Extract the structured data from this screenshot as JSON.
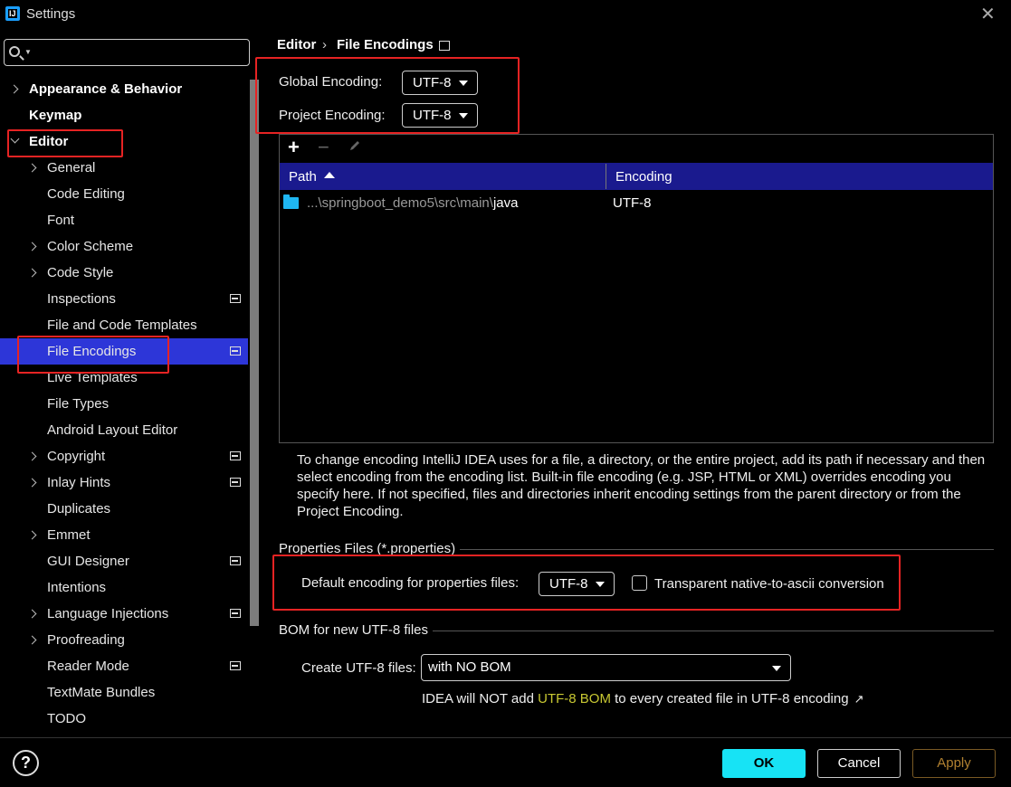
{
  "window": {
    "title": "Settings",
    "app_icon_text": "IJ"
  },
  "search": {
    "placeholder": ""
  },
  "sidebar": {
    "items": [
      {
        "label": "Appearance & Behavior"
      },
      {
        "label": "Keymap"
      },
      {
        "label": "Editor"
      },
      {
        "label": "General"
      },
      {
        "label": "Code Editing"
      },
      {
        "label": "Font"
      },
      {
        "label": "Color Scheme"
      },
      {
        "label": "Code Style"
      },
      {
        "label": "Inspections"
      },
      {
        "label": "File and Code Templates"
      },
      {
        "label": "File Encodings"
      },
      {
        "label": "Live Templates"
      },
      {
        "label": "File Types"
      },
      {
        "label": "Android Layout Editor"
      },
      {
        "label": "Copyright"
      },
      {
        "label": "Inlay Hints"
      },
      {
        "label": "Duplicates"
      },
      {
        "label": "Emmet"
      },
      {
        "label": "GUI Designer"
      },
      {
        "label": "Intentions"
      },
      {
        "label": "Language Injections"
      },
      {
        "label": "Proofreading"
      },
      {
        "label": "Reader Mode"
      },
      {
        "label": "TextMate Bundles"
      },
      {
        "label": "TODO"
      }
    ]
  },
  "breadcrumb": {
    "parent": "Editor",
    "separator": "›",
    "current": "File Encodings"
  },
  "encoding": {
    "global_label": "Global Encoding:",
    "global_value": "UTF-8",
    "project_label": "Project Encoding:",
    "project_value": "UTF-8"
  },
  "toolbar": {
    "add": "+",
    "remove": "−"
  },
  "table": {
    "headers": {
      "path": "Path",
      "encoding": "Encoding"
    },
    "rows": [
      {
        "path_prefix": "...\\springboot_demo5\\src\\main\\",
        "path_last": "java",
        "encoding": "UTF-8"
      }
    ]
  },
  "description": "To change encoding IntelliJ IDEA uses for a file, a directory, or the entire project, add its path if necessary and then select encoding from the encoding list. Built-in file encoding (e.g. JSP, HTML or XML) overrides encoding you specify here. If not specified, files and directories inherit encoding settings from the parent directory or from the Project Encoding.",
  "properties": {
    "group_title": "Properties Files (*.properties)",
    "default_label": "Default encoding for properties files:",
    "default_value": "UTF-8",
    "transparent_label": "Transparent native-to-ascii conversion",
    "transparent_checked": false
  },
  "bom": {
    "group_title": "BOM for new UTF-8 files",
    "create_label": "Create UTF-8 files:",
    "create_value": "with NO BOM",
    "hint_before": "IDEA will NOT add ",
    "hint_link": "UTF-8 BOM",
    "hint_after": " to every created file in UTF-8 encoding",
    "hint_arrow": "↗"
  },
  "footer": {
    "help": "?",
    "ok": "OK",
    "cancel": "Cancel",
    "apply": "Apply"
  }
}
